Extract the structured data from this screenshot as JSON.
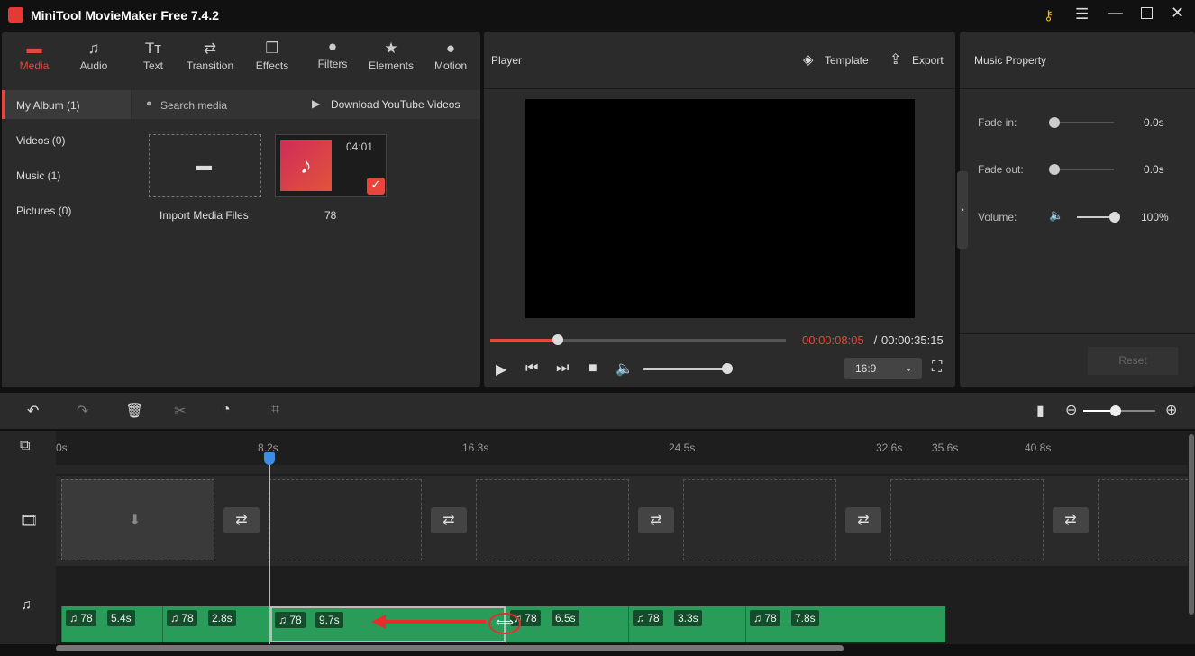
{
  "app": {
    "title": "MiniTool MovieMaker Free 7.4.2"
  },
  "tabs": [
    {
      "label": "Media",
      "icon": "folder-icon",
      "active": true
    },
    {
      "label": "Audio",
      "icon": "music-icon"
    },
    {
      "label": "Text",
      "icon": "text-icon"
    },
    {
      "label": "Transition",
      "icon": "transition-icon"
    },
    {
      "label": "Effects",
      "icon": "effects-icon"
    },
    {
      "label": "Filters",
      "icon": "filters-icon"
    },
    {
      "label": "Elements",
      "icon": "elements-icon"
    },
    {
      "label": "Motion",
      "icon": "motion-icon"
    }
  ],
  "sidebar": {
    "items": [
      {
        "label": "My Album (1)"
      },
      {
        "label": "Videos (0)"
      },
      {
        "label": "Music (1)"
      },
      {
        "label": "Pictures (0)"
      }
    ]
  },
  "media": {
    "search_placeholder": "Search media",
    "download_label": "Download YouTube Videos",
    "import_label": "Import Media Files",
    "item": {
      "name": "78",
      "duration": "04:01"
    }
  },
  "player": {
    "title": "Player",
    "template_label": "Template",
    "export_label": "Export",
    "current_time": "00:00:08:05",
    "separator": " / ",
    "total_time": "00:00:35:15",
    "progress": 0.23,
    "volume": 0.9,
    "aspect": "16:9"
  },
  "property": {
    "title": "Music Property",
    "fade_in_label": "Fade in:",
    "fade_in_value": "0.0s",
    "fade_out_label": "Fade out:",
    "fade_out_value": "0.0s",
    "volume_label": "Volume:",
    "volume_value": "100%",
    "reset_label": "Reset"
  },
  "ruler": [
    "0s",
    "8.2s",
    "16.3s",
    "24.5s",
    "32.6s",
    "35.6s",
    "40.8s"
  ],
  "clips": [
    {
      "name": "78",
      "duration": "5.4s"
    },
    {
      "name": "78",
      "duration": "2.8s"
    },
    {
      "name": "78",
      "duration": "9.7s"
    },
    {
      "name": "78",
      "duration": "6.5s"
    },
    {
      "name": "78",
      "duration": "3.3s"
    },
    {
      "name": "78",
      "duration": "7.8s"
    }
  ],
  "colors": {
    "accent": "#e8453c",
    "clip": "#2a9c5a",
    "playhead": "#3a8ee6"
  }
}
